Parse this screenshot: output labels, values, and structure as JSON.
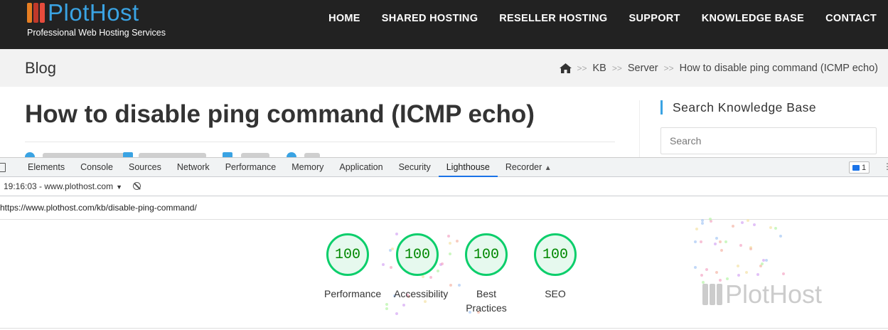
{
  "site": {
    "logo_text": "PlotHost",
    "tagline": "Professional Web Hosting Services",
    "nav": [
      "HOME",
      "SHARED HOSTING",
      "RESELLER HOSTING",
      "SUPPORT",
      "KNOWLEDGE BASE",
      "CONTACT"
    ],
    "page_title": "Blog",
    "breadcrumb": [
      "KB",
      "Server",
      "How to disable ping command (ICMP echo)"
    ],
    "breadcrumb_sep": ">>",
    "article_title": "How to disable ping command (ICMP echo)",
    "sidebar_title": "Search Knowledge Base",
    "search_placeholder": "Search",
    "accent": "#3aa3e3"
  },
  "devtools": {
    "tabs": [
      "Elements",
      "Console",
      "Sources",
      "Network",
      "Performance",
      "Memory",
      "Application",
      "Security",
      "Lighthouse",
      "Recorder"
    ],
    "active_tab": "Lighthouse",
    "issues_count": "1",
    "report_label": "19:16:03 - www.plothost.com",
    "url": "https://www.plothost.com/kb/disable-ping-command/",
    "scores": [
      {
        "value": "100",
        "label": "Performance"
      },
      {
        "value": "100",
        "label": "Accessibility"
      },
      {
        "value": "100",
        "label": "Best Practices"
      },
      {
        "value": "100",
        "label": "SEO"
      }
    ],
    "score_color": "#0cce6b"
  },
  "watermark": "PlotHost"
}
